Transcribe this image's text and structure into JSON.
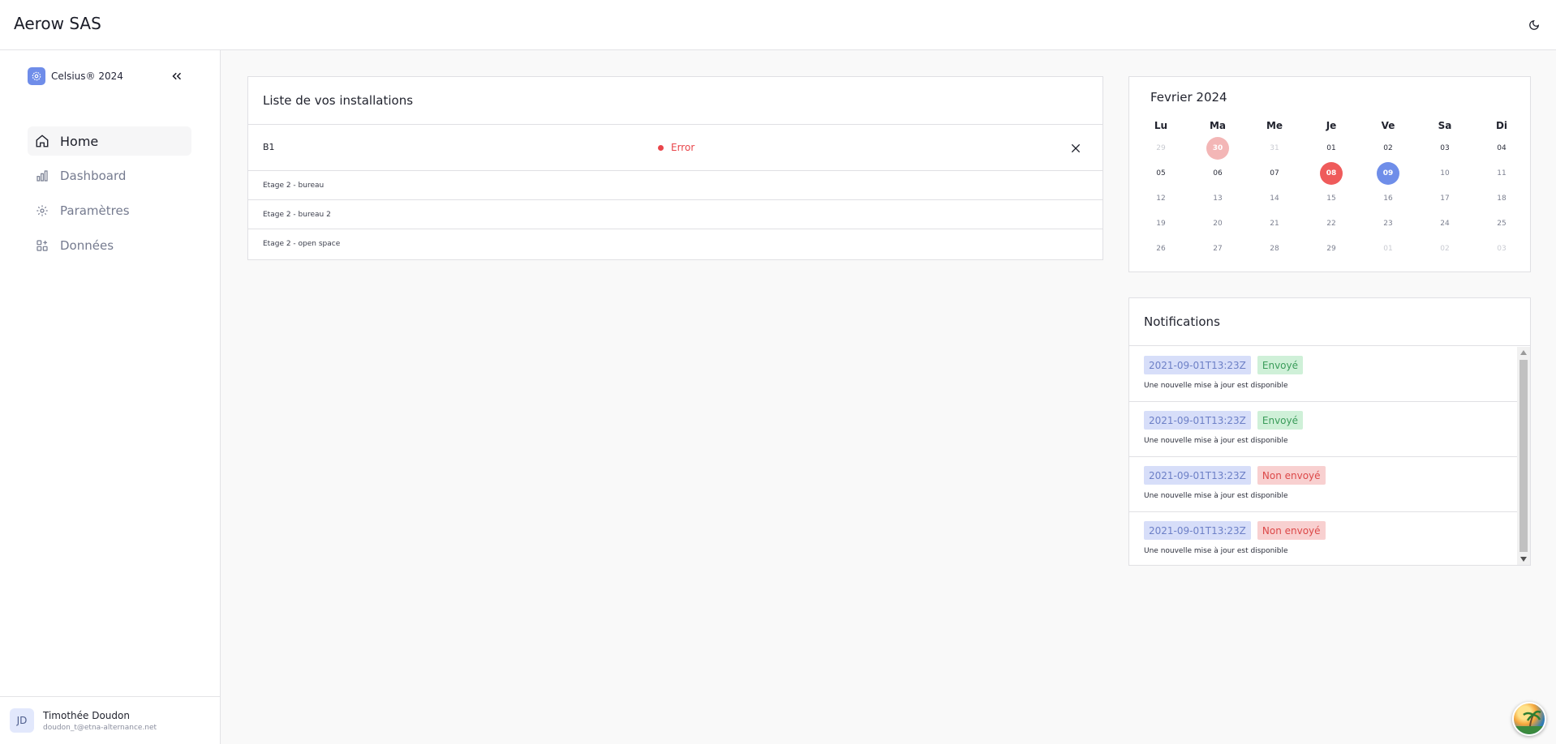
{
  "header": {
    "brand": "Aerow SAS",
    "theme_icon": "moon-icon"
  },
  "sidebar": {
    "app_name": "Celsius® 2024",
    "collapse_icon": "chevrons-left-icon",
    "items": [
      {
        "label": "Home",
        "icon": "home-icon",
        "active": true
      },
      {
        "label": "Dashboard",
        "icon": "bar-chart-icon",
        "active": false
      },
      {
        "label": "Paramètres",
        "icon": "gear-icon",
        "active": false
      },
      {
        "label": "Données",
        "icon": "grid-plus-icon",
        "active": false
      }
    ],
    "user": {
      "initials": "JD",
      "name": "Timothée Doudon",
      "email": "doudon_t@etna-alternance.net"
    }
  },
  "installations": {
    "title": "Liste de vos installations",
    "main": {
      "name": "B1",
      "status": "Error",
      "status_color": "#e9454a"
    },
    "rows": [
      "Etage 2 - bureau",
      "Etage 2 - bureau 2",
      "Etage 2 - open space"
    ]
  },
  "calendar": {
    "title": "Fevrier 2024",
    "weekdays": [
      "Lu",
      "Ma",
      "Me",
      "Je",
      "Ve",
      "Sa",
      "Di"
    ],
    "days": [
      {
        "d": "29",
        "s": "other"
      },
      {
        "d": "30",
        "s": "pink"
      },
      {
        "d": "31",
        "s": "other"
      },
      {
        "d": "01",
        "s": ""
      },
      {
        "d": "02",
        "s": ""
      },
      {
        "d": "03",
        "s": ""
      },
      {
        "d": "04",
        "s": ""
      },
      {
        "d": "05",
        "s": ""
      },
      {
        "d": "06",
        "s": ""
      },
      {
        "d": "07",
        "s": ""
      },
      {
        "d": "08",
        "s": "red"
      },
      {
        "d": "09",
        "s": "blue"
      },
      {
        "d": "10",
        "s": "muted"
      },
      {
        "d": "11",
        "s": "muted"
      },
      {
        "d": "12",
        "s": "muted"
      },
      {
        "d": "13",
        "s": "muted"
      },
      {
        "d": "14",
        "s": "muted"
      },
      {
        "d": "15",
        "s": "muted"
      },
      {
        "d": "16",
        "s": "muted"
      },
      {
        "d": "17",
        "s": "muted"
      },
      {
        "d": "18",
        "s": "muted"
      },
      {
        "d": "19",
        "s": "muted"
      },
      {
        "d": "20",
        "s": "muted"
      },
      {
        "d": "21",
        "s": "muted"
      },
      {
        "d": "22",
        "s": "muted"
      },
      {
        "d": "23",
        "s": "muted"
      },
      {
        "d": "24",
        "s": "muted"
      },
      {
        "d": "25",
        "s": "muted"
      },
      {
        "d": "26",
        "s": "muted"
      },
      {
        "d": "27",
        "s": "muted"
      },
      {
        "d": "28",
        "s": "muted"
      },
      {
        "d": "29",
        "s": "muted"
      },
      {
        "d": "01",
        "s": "other"
      },
      {
        "d": "02",
        "s": "other"
      },
      {
        "d": "03",
        "s": "other"
      }
    ]
  },
  "notifications": {
    "title": "Notifications",
    "items": [
      {
        "date": "2021-09-01T13:23Z",
        "status": "Envoyé",
        "sent": true,
        "message": "Une nouvelle mise à jour est disponible"
      },
      {
        "date": "2021-09-01T13:23Z",
        "status": "Envoyé",
        "sent": true,
        "message": "Une nouvelle mise à jour est disponible"
      },
      {
        "date": "2021-09-01T13:23Z",
        "status": "Non envoyé",
        "sent": false,
        "message": "Une nouvelle mise à jour est disponible"
      },
      {
        "date": "2021-09-01T13:23Z",
        "status": "Non envoyé",
        "sent": false,
        "message": "Une nouvelle mise à jour est disponible"
      }
    ]
  },
  "colors": {
    "accent": "#6f8ee9",
    "error": "#e9454a",
    "sent": "#3a9c5a"
  }
}
